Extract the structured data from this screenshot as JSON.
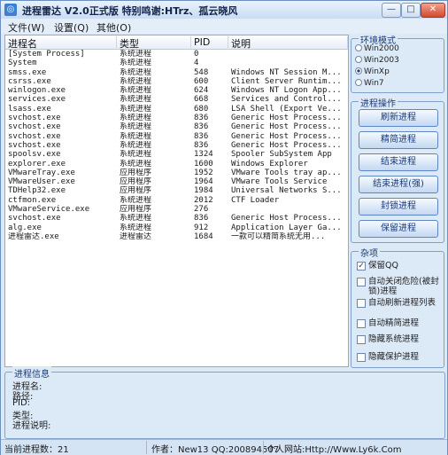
{
  "window": {
    "title": "进程雷达 V2.0正式版 特别鸣谢:HTrz、孤云晓风",
    "app_icon": "radar-icon",
    "controls": {
      "minimize": "—",
      "maximize": "□",
      "close": "✕"
    }
  },
  "menu": [
    "文件(W)",
    "设置(Q)",
    "其他(O)"
  ],
  "process_list": {
    "columns": [
      "进程名",
      "类型",
      "PID",
      "说明"
    ],
    "rows": [
      [
        "[System Process]",
        "系统进程",
        "0",
        ""
      ],
      [
        "System",
        "系统进程",
        "4",
        ""
      ],
      [
        "smss.exe",
        "系统进程",
        "548",
        "Windows NT Session M..."
      ],
      [
        "csrss.exe",
        "系统进程",
        "600",
        "Client Server Runtim..."
      ],
      [
        "winlogon.exe",
        "系统进程",
        "624",
        "Windows NT Logon App..."
      ],
      [
        "services.exe",
        "系统进程",
        "668",
        "Services and Control..."
      ],
      [
        "lsass.exe",
        "系统进程",
        "680",
        "LSA Shell (Export Ve..."
      ],
      [
        "svchost.exe",
        "系统进程",
        "836",
        "Generic Host Process..."
      ],
      [
        "svchost.exe",
        "系统进程",
        "836",
        "Generic Host Process..."
      ],
      [
        "svchost.exe",
        "系统进程",
        "836",
        "Generic Host Process..."
      ],
      [
        "svchost.exe",
        "系统进程",
        "836",
        "Generic Host Process..."
      ],
      [
        "spoolsv.exe",
        "系统进程",
        "1324",
        "Spooler SubSystem App"
      ],
      [
        "explorer.exe",
        "系统进程",
        "1600",
        "Windows Explorer"
      ],
      [
        "VMwareTray.exe",
        "应用程序",
        "1952",
        "VMware Tools tray ap..."
      ],
      [
        "VMwareUser.exe",
        "应用程序",
        "1964",
        "VMware Tools Service"
      ],
      [
        "TDHelp32.exe",
        "应用程序",
        "1984",
        "Universal Networks S..."
      ],
      [
        "ctfmon.exe",
        "系统进程",
        "2012",
        "CTF Loader"
      ],
      [
        "VMwareService.exe",
        "应用程序",
        "276",
        ""
      ],
      [
        "svchost.exe",
        "系统进程",
        "836",
        "Generic Host Process..."
      ],
      [
        "alg.exe",
        "系统进程",
        "912",
        "Application Layer Ga..."
      ],
      [
        "进程雷达.exe",
        "进程雷达",
        "1684",
        "一款可以精简系统无用..."
      ]
    ]
  },
  "environment": {
    "title": "环境模式",
    "options": [
      "Win2000",
      "Win2003",
      "WinXp",
      "Win7"
    ],
    "selected_index": 2
  },
  "operations": {
    "title": "进程操作",
    "buttons": [
      "刷新进程",
      "精简进程",
      "结束进程",
      "结束进程(强)",
      "封锁进程",
      "保留进程"
    ]
  },
  "misc": {
    "title": "杂项",
    "options": [
      {
        "label": "保留QQ",
        "checked": true
      },
      {
        "label": "自动关闭危险(被封锁)进程",
        "checked": false
      },
      {
        "label": "自动刷新进程列表",
        "checked": false
      },
      {
        "label": "自动精简进程",
        "checked": false
      },
      {
        "label": "隐藏系统进程",
        "checked": false
      },
      {
        "label": "隐藏保护进程",
        "checked": false
      }
    ]
  },
  "process_info": {
    "title": "进程信息",
    "fields": [
      "进程名:",
      "路径:",
      "PID:",
      "类型:",
      "进程说明:"
    ]
  },
  "statusbar": {
    "count": "当前进程数：21",
    "author": "作者：New13 QQ:200894507",
    "site": "个人网站:Http://Www.Ly6k.Com"
  }
}
